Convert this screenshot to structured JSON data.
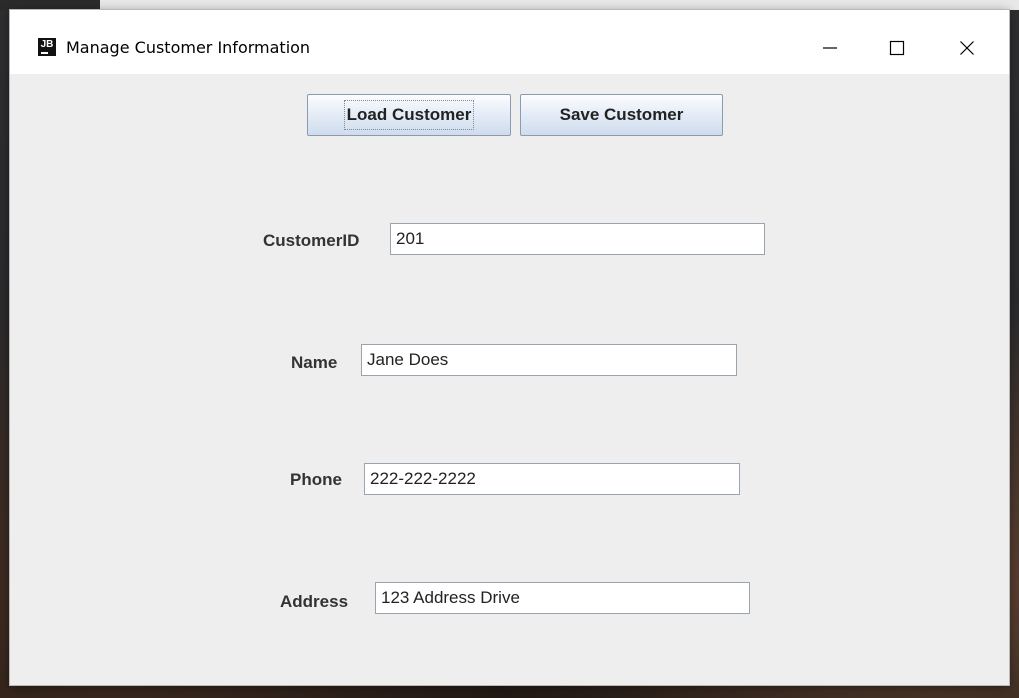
{
  "window": {
    "title": "Manage Customer Information",
    "icon_text": "JB",
    "controls": {
      "minimize": "minimize-icon",
      "maximize": "maximize-icon",
      "close": "close-icon"
    }
  },
  "toolbar": {
    "load_label": "Load Customer",
    "save_label": "Save Customer"
  },
  "form": {
    "customer_id": {
      "label": "CustomerID",
      "value": "201"
    },
    "name": {
      "label": "Name",
      "value": "Jane Does"
    },
    "phone": {
      "label": "Phone",
      "value": "222-222-2222"
    },
    "address": {
      "label": "Address",
      "value": "123 Address Drive"
    }
  },
  "colors": {
    "button_gradient_top": "#fbfcfe",
    "button_gradient_bottom": "#cfdced",
    "button_border": "#8a9cb2",
    "content_background": "#eeeeee",
    "titlebar_background": "#ffffff"
  }
}
